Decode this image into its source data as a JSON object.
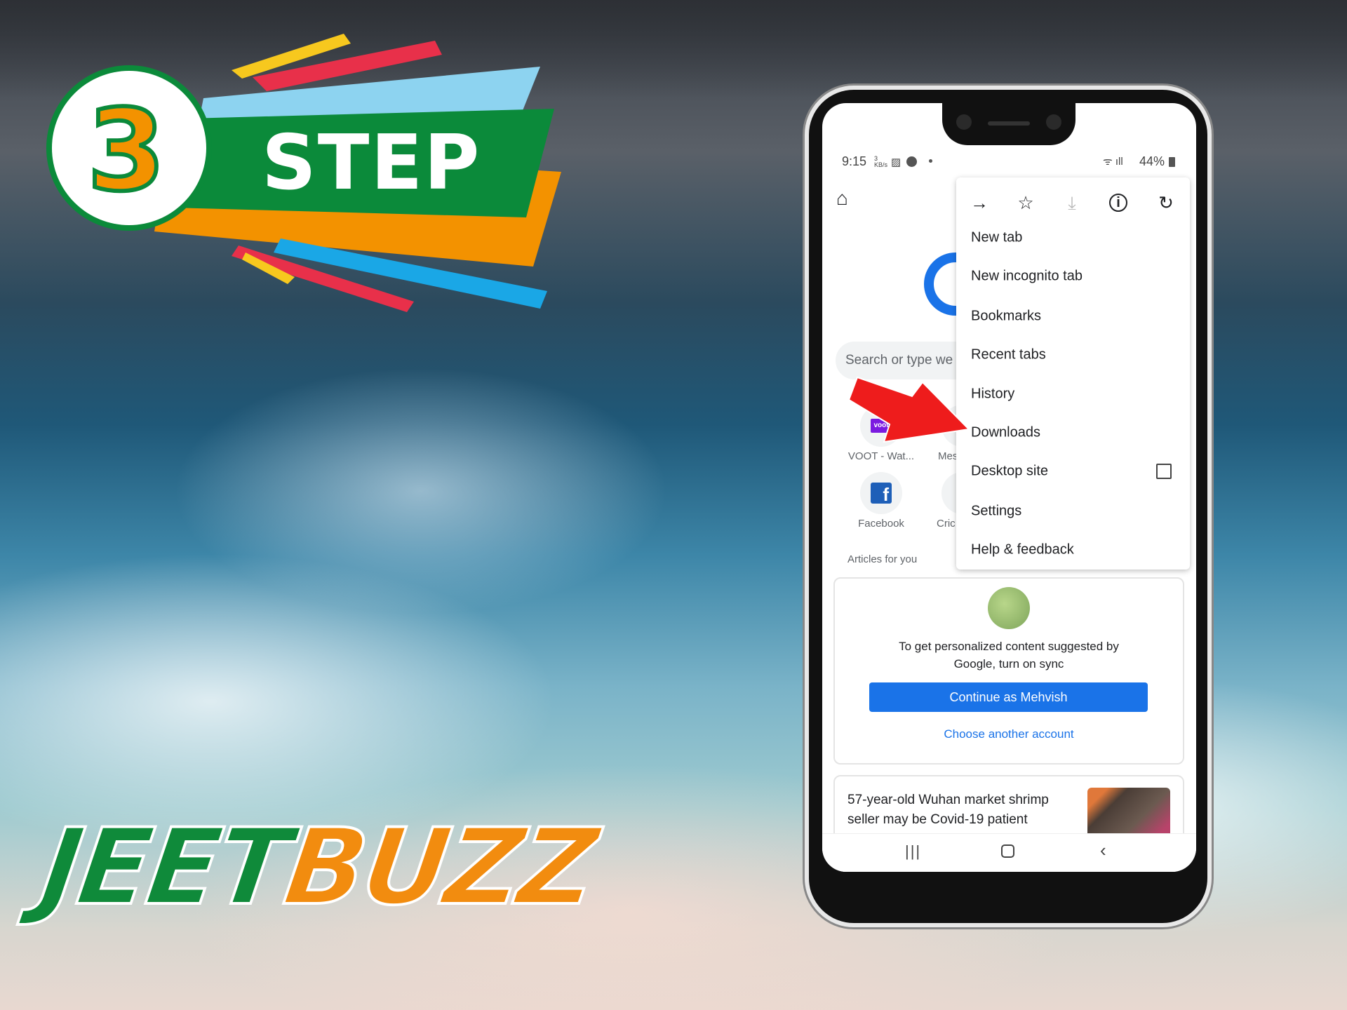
{
  "badge": {
    "number": "3",
    "label": "STEP",
    "colors": {
      "green": "#0b8a3a",
      "orange": "#f39200",
      "sky": "#8dd3f0",
      "red": "#e8304a",
      "yellow": "#f7c81e"
    }
  },
  "logo": {
    "part1": "JEET",
    "part2": "BUZZ",
    "colors": {
      "green": "#0f8a3a",
      "orange": "#f28c0f"
    }
  },
  "status_bar": {
    "time": "9:15",
    "speed": "3 KB/s",
    "battery": "44%"
  },
  "menu": {
    "icons": [
      "forward-icon",
      "star-icon",
      "download-icon",
      "info-icon",
      "refresh-icon"
    ],
    "items": [
      "New tab",
      "New incognito tab",
      "Bookmarks",
      "Recent tabs",
      "History",
      "Downloads",
      "Desktop site",
      "Settings",
      "Help & feedback"
    ],
    "desktop_site_checked": false
  },
  "search": {
    "placeholder": "Search or type we"
  },
  "shortcuts": [
    {
      "label": "VOOT - Wat...",
      "icon_text": "voot"
    },
    {
      "label": "Mes"
    },
    {
      "label": "Facebook",
      "icon_text": "f"
    },
    {
      "label": "Cric"
    }
  ],
  "articles_header": "Articles for you",
  "sync_card": {
    "message_line1": "To get personalized content suggested by",
    "message_line2": "Google, turn on sync",
    "continue_button": "Continue as Mehvish",
    "choose_link": "Choose another account",
    "accent": "#1a73e8"
  },
  "article": {
    "line1": "57-year-old Wuhan market shrimp",
    "line2": "seller may be Covid-19 patient"
  }
}
